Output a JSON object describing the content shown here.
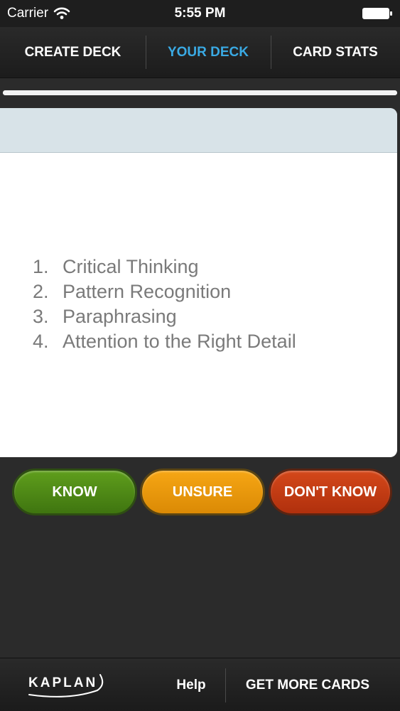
{
  "status_bar": {
    "carrier": "Carrier",
    "time": "5:55 PM"
  },
  "nav": {
    "tabs": [
      {
        "label": "CREATE DECK",
        "active": false
      },
      {
        "label": "YOUR DECK",
        "active": true
      },
      {
        "label": "CARD STATS",
        "active": false
      }
    ]
  },
  "progress": {
    "fraction": 1.0
  },
  "card": {
    "items": [
      {
        "num": "1.",
        "text": "Critical Thinking"
      },
      {
        "num": "2.",
        "text": "Pattern Recognition"
      },
      {
        "num": "3.",
        "text": "Paraphrasing"
      },
      {
        "num": "4.",
        "text": "Attention to the Right Detail"
      }
    ]
  },
  "answers": {
    "know_label": "KNOW",
    "unsure_label": "UNSURE",
    "dont_know_label": "DON'T KNOW"
  },
  "footer": {
    "logo_text": "KAPLAN",
    "help_label": "Help",
    "more_label": "GET MORE CARDS"
  },
  "colors": {
    "active_tab": "#3aaae4",
    "know": "#4f8a16",
    "unsure": "#f0a010",
    "dont_know": "#c23d13"
  }
}
